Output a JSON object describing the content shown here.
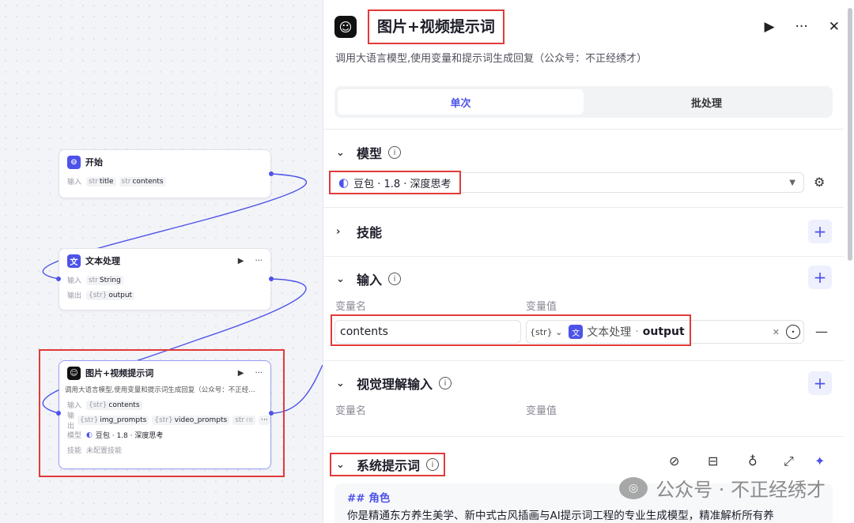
{
  "canvas": {
    "start_node": {
      "title": "开始",
      "input_key": "输入",
      "inputs": [
        {
          "type": "str",
          "name": "title"
        },
        {
          "type": "str",
          "name": "contents"
        }
      ]
    },
    "text_node": {
      "title": "文本处理",
      "input_key": "输入",
      "output_key": "输出",
      "input": {
        "type": "str",
        "name": "String"
      },
      "output": {
        "type": "{str}",
        "name": "output"
      }
    },
    "llm_node": {
      "title": "图片+视频提示词",
      "desc": "调用大语言模型,使用变量和提示词生成回复（公众号：不正经…",
      "input_key": "输入",
      "output_key": "输出",
      "model_key": "模型",
      "skill_key": "技能",
      "input": {
        "type": "{str}",
        "name": "contents"
      },
      "outputs": [
        {
          "type": "{str}",
          "name": "img_prompts"
        },
        {
          "type": "{str}",
          "name": "video_prompts"
        },
        {
          "type": "str",
          "name": "re"
        }
      ],
      "more": "···",
      "model": "豆包 · 1.8 · 深度思考",
      "skill": "未配置技能"
    },
    "colors": {
      "accent": "#4d53e8",
      "highlight": "#e23a3a"
    }
  },
  "panel": {
    "title": "图片+视频提示词",
    "description": "调用大语言模型,使用变量和提示词生成回复（公众号：不正经绣才）",
    "tabs": [
      {
        "label": "单次",
        "active": true
      },
      {
        "label": "批处理",
        "active": false
      }
    ],
    "model": {
      "heading": "模型",
      "value": "豆包 · 1.8 · 深度思考"
    },
    "skills": {
      "heading": "技能"
    },
    "inputs": {
      "heading": "输入",
      "col_name": "变量名",
      "col_value": "变量值",
      "var_name": "contents",
      "var_type": "{str}",
      "ref_node": "文本处理",
      "ref_sep": "·",
      "ref_field": "output"
    },
    "vision": {
      "heading": "视觉理解输入",
      "col_name": "变量名",
      "col_value": "变量值"
    },
    "system_prompt": {
      "heading": "系统提示词",
      "h2": "## 角色",
      "line": "你是精通东方养生美学、新中式古风插画与AI提示词工程的专业生成模型，精准解析所有养"
    }
  },
  "watermark": "公众号 · 不正经绣才"
}
